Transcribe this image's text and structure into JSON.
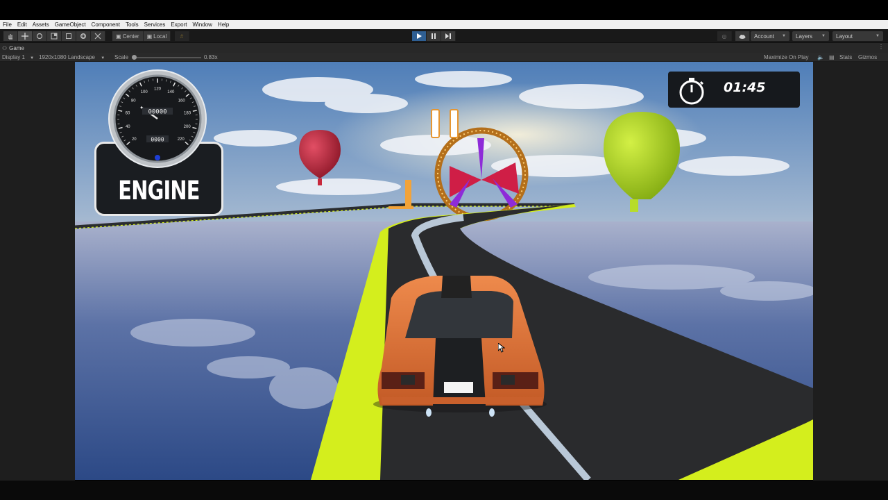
{
  "menu": [
    "File",
    "Edit",
    "Assets",
    "GameObject",
    "Component",
    "Tools",
    "Services",
    "Export",
    "Window",
    "Help"
  ],
  "toolbar": {
    "tools": [
      "hand-icon",
      "move-icon",
      "rotate-icon",
      "scale-icon",
      "rect-icon",
      "transform-icon",
      "custom-tool-icon"
    ],
    "pivot_label": "Center",
    "space_label": "Local",
    "account_label": "Account",
    "layers_label": "Layers",
    "layout_label": "Layout"
  },
  "tab": {
    "label": "Game"
  },
  "gamebar": {
    "display": "Display 1",
    "resolution": "1920x1080 Landscape",
    "scale_label": "Scale",
    "scale_value": "0.83x",
    "maximize": "Maximize On Play",
    "stats": "Stats",
    "gizmos": "Gizmos"
  },
  "hud": {
    "engine_label": "ENGINE",
    "timer": "01:45",
    "gauge_ticks": [
      "20",
      "40",
      "60",
      "80",
      "100",
      "120",
      "140",
      "160",
      "180",
      "200",
      "220"
    ],
    "odometer": "00000",
    "trip": "0000"
  },
  "colors": {
    "accent": "#2f5f93",
    "track_edge": "#d4ee1d",
    "car": "#e07a3c",
    "balloon_red": "#c8283c",
    "balloon_green": "#b7dc2a"
  }
}
